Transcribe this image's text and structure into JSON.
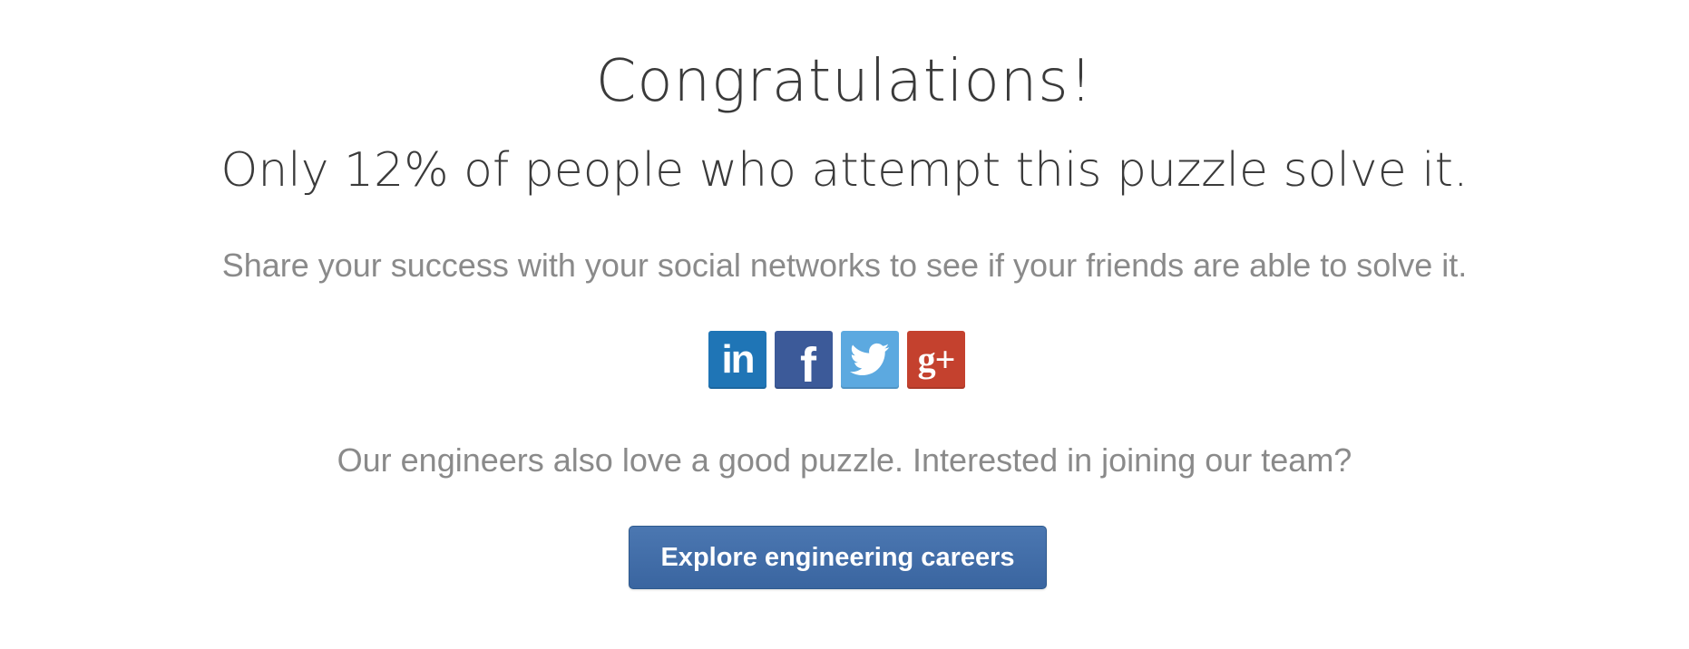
{
  "heading": {
    "title": "Congratulations!",
    "subtitle": "Only 12% of people who attempt this puzzle solve it."
  },
  "share": {
    "prompt": "Share your success with your social networks to see if your friends are able to solve it.",
    "networks": [
      {
        "name": "linkedin",
        "icon": "linkedin-icon",
        "glyph": "in",
        "color": "#1f75b6"
      },
      {
        "name": "facebook",
        "icon": "facebook-icon",
        "glyph": "f",
        "color": "#3c5a99"
      },
      {
        "name": "twitter",
        "icon": "twitter-icon",
        "glyph": "bird",
        "color": "#5ca9e0"
      },
      {
        "name": "google-plus",
        "icon": "google-plus-icon",
        "glyph": "g+",
        "color": "#c4412e"
      }
    ]
  },
  "careers": {
    "prompt": "Our engineers also love a good puzzle. Interested in joining our team?",
    "button_label": "Explore engineering careers",
    "button_color": "#416ea8"
  }
}
